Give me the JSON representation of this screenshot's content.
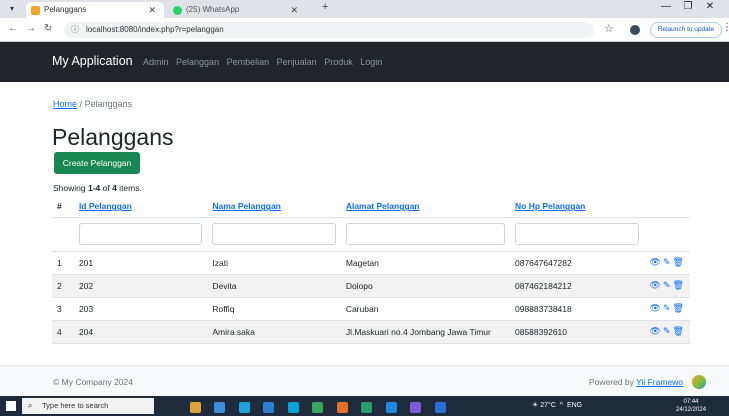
{
  "browser": {
    "tabs": [
      {
        "title": "Pelanggans",
        "active": true
      },
      {
        "title": "(25) WhatsApp",
        "active": false
      }
    ],
    "url": "localhost:8080/index.php?r=pelanggan",
    "relaunch_label": "Relaunch to update"
  },
  "navbar": {
    "brand": "My Application",
    "links": [
      "Admin",
      "Pelanggan",
      "Pembelian",
      "Penjualan",
      "Produk",
      "Login"
    ]
  },
  "breadcrumb": {
    "home": "Home",
    "separator": "/",
    "current": "Pelanggans"
  },
  "page": {
    "title": "Pelanggans",
    "create_button": "Create Pelanggan",
    "summary_prefix": "Showing ",
    "summary_range": "1-4",
    "summary_of": " of ",
    "summary_total": "4",
    "summary_suffix": " items."
  },
  "table": {
    "columns": [
      "#",
      "Id Pelanggan",
      "Nama Pelanggan",
      "Alamat Pelanggan",
      "No Hp Pelanggan"
    ],
    "rows": [
      [
        "1",
        "201",
        "Izati",
        "Magetan",
        "087647647282"
      ],
      [
        "2",
        "202",
        "Devita",
        "Dolopo",
        "087462184212"
      ],
      [
        "3",
        "203",
        "Roffiq",
        "Caruban",
        "098883738418"
      ],
      [
        "4",
        "204",
        "Amira saka",
        "Jl.Maskuari no.4 Jombang Jawa Timur",
        "08588392610"
      ]
    ],
    "action_icons": [
      "eye-icon",
      "pencil-icon",
      "trash-icon"
    ]
  },
  "footer": {
    "copyright": "© My Company 2024",
    "powered_prefix": "Powered by ",
    "powered_link": "Yii Framewo"
  },
  "taskbar": {
    "search_placeholder": "Type here to search",
    "weather": "27°C",
    "language": "ENG",
    "time": "07:44",
    "date": "24/12/2024"
  },
  "colors": {
    "navbar_bg": "#212529",
    "create_button_bg": "#198754",
    "link": "#0d6efd",
    "stripe": "#f2f2f2"
  }
}
